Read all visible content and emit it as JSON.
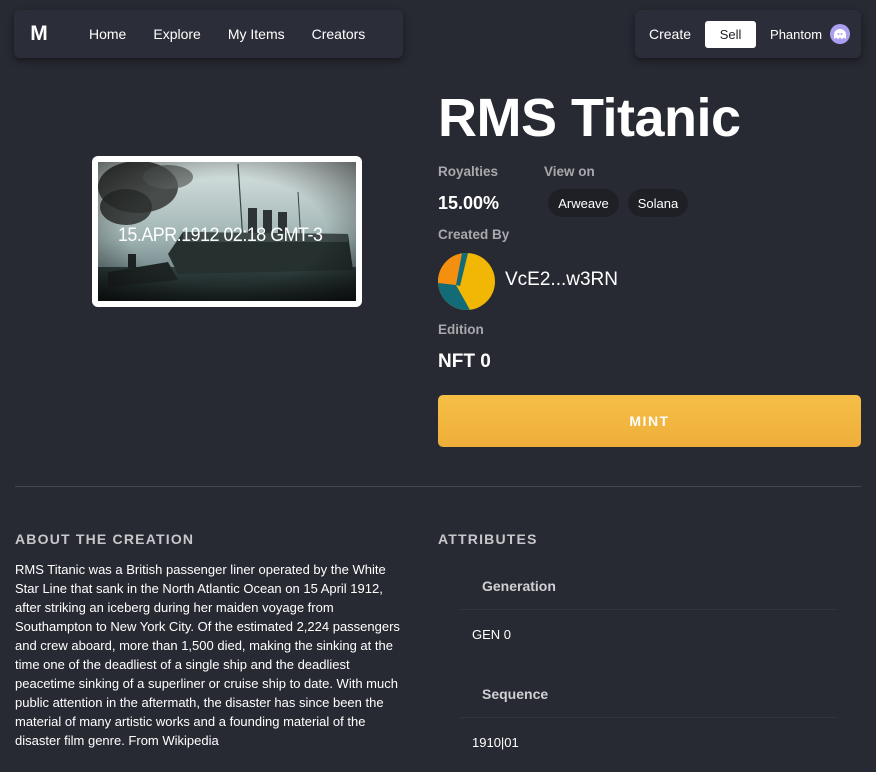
{
  "nav": {
    "logo": "M",
    "links": [
      "Home",
      "Explore",
      "My Items",
      "Creators"
    ],
    "create_label": "Create",
    "sell_label": "Sell",
    "wallet_label": "Phantom",
    "wallet_icon": "phantom-ghost-icon"
  },
  "item": {
    "title": "RMS Titanic",
    "image_caption": "15.APR.1912 02:18 GMT-3",
    "royalties_label": "Royalties",
    "royalties_value": "15.00%",
    "view_on_label": "View on",
    "view_on_links": [
      "Arweave",
      "Solana"
    ],
    "created_by_label": "Created By",
    "creator_address": "VcE2...w3RN",
    "edition_label": "Edition",
    "edition_value": "NFT 0",
    "mint_label": "MINT"
  },
  "about": {
    "heading": "ABOUT THE CREATION",
    "text": "RMS Titanic was a British passenger liner operated by the White Star Line that sank in the North Atlantic Ocean on 15 April 1912, after striking an iceberg during her maiden voyage from Southampton to New York City. Of the estimated 2,224 passengers and crew aboard, more than 1,500 died, making the sinking at the time one of the deadliest of a single ship and the deadliest peacetime sinking of a superliner or cruise ship to date. With much public attention in the aftermath, the disaster has since been the material of many artistic works and a founding material of the disaster film genre. From Wikipedia"
  },
  "attributes": {
    "heading": "ATTRIBUTES",
    "items": [
      {
        "trait": "Generation",
        "value": "GEN 0"
      },
      {
        "trait": "Sequence",
        "value": "1910|01"
      }
    ]
  },
  "colors": {
    "background": "#282a33",
    "nav_background": "#2b2e38",
    "mint_button": "#f4b942",
    "pill_background": "#1f2026",
    "avatar_orange": "#f58f10",
    "avatar_yellow": "#f2b705",
    "avatar_teal": "#136b78"
  }
}
